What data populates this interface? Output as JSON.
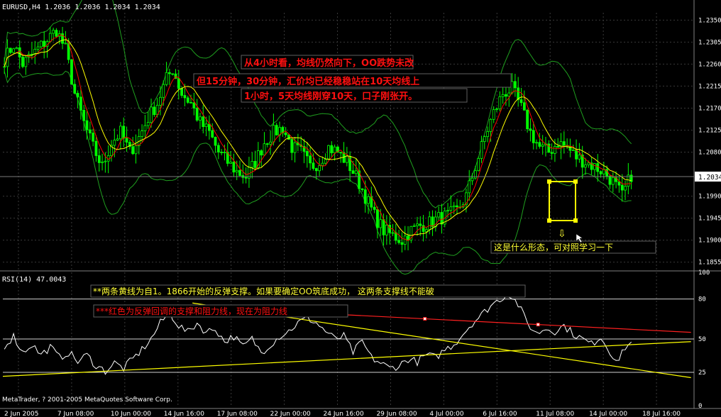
{
  "window": {
    "price_title": "EURUSD,H4  1.2036 1.2036 1.2034 1.2034",
    "rsi_title": "RSI(14) 47.0043",
    "copyright": "MetaTrader, ? 2001-2005 MetaQuotes Software Corp."
  },
  "colors": {
    "background": "#000000",
    "grid": "#3a3a3a",
    "candle": "#00ff00",
    "ma_fast": "#ff0000",
    "ma_slow": "#ffff00",
    "bollinger": "#1f9f1f",
    "rsi_line": "#ffffff",
    "annotation_red": "#ff1010",
    "annotation_yellow": "#ffff33"
  },
  "chart_data": [
    {
      "type": "candlestick",
      "title": "EURUSD,H4",
      "ohlc_last": {
        "open": 1.2036,
        "high": 1.2036,
        "low": 1.2034,
        "close": 1.2034
      },
      "current_price": "1.2034",
      "ylim": [
        1.184,
        1.2365
      ],
      "y_ticks": [
        "1.2350",
        "1.2305",
        "1.2260",
        "1.2215",
        "1.2170",
        "1.2125",
        "1.2080",
        "1.1990",
        "1.1945",
        "1.1900",
        "1.1855"
      ],
      "x_ticks": [
        "2 Jun 2005",
        "7 Jun 08:00",
        "10 Jun 00:00",
        "14 Jun 16:00",
        "17 Jun 08:00",
        "22 Jun 00:00",
        "24 Jun 16:00",
        "29 Jun 08:00",
        "4 Jul 00:00",
        "6 Jul 16:00",
        "11 Jul 08:00",
        "14 Jul 00:00",
        "18 Jul 16:00"
      ],
      "grid": true,
      "close_trace": [
        [
          0,
          1.227
        ],
        [
          3,
          1.23
        ],
        [
          6,
          1.226
        ],
        [
          10,
          1.2285
        ],
        [
          14,
          1.231
        ],
        [
          17,
          1.233
        ],
        [
          20,
          1.229
        ],
        [
          23,
          1.22
        ],
        [
          26,
          1.214
        ],
        [
          29,
          1.209
        ],
        [
          32,
          1.205
        ],
        [
          35,
          1.21
        ],
        [
          38,
          1.212
        ],
        [
          41,
          1.208
        ],
        [
          44,
          1.211
        ],
        [
          47,
          1.215
        ],
        [
          50,
          1.218
        ],
        [
          53,
          1.223
        ],
        [
          55,
          1.225
        ],
        [
          58,
          1.22
        ],
        [
          61,
          1.218
        ],
        [
          64,
          1.214
        ],
        [
          67,
          1.212
        ],
        [
          70,
          1.208
        ],
        [
          73,
          1.206
        ],
        [
          76,
          1.204
        ],
        [
          79,
          1.203
        ],
        [
          82,
          1.206
        ],
        [
          85,
          1.21
        ],
        [
          88,
          1.212
        ],
        [
          91,
          1.213
        ],
        [
          94,
          1.209
        ],
        [
          97,
          1.208
        ],
        [
          100,
          1.205
        ],
        [
          103,
          1.206
        ],
        [
          106,
          1.209
        ],
        [
          109,
          1.208
        ],
        [
          112,
          1.206
        ],
        [
          115,
          1.203
        ],
        [
          118,
          1.199
        ],
        [
          121,
          1.195
        ],
        [
          124,
          1.192
        ],
        [
          127,
          1.191
        ],
        [
          130,
          1.19
        ],
        [
          133,
          1.192
        ],
        [
          136,
          1.193
        ],
        [
          139,
          1.1935
        ],
        [
          142,
          1.1945
        ],
        [
          145,
          1.195
        ],
        [
          148,
          1.196
        ],
        [
          151,
          1.199
        ],
        [
          154,
          1.205
        ],
        [
          157,
          1.211
        ],
        [
          160,
          1.216
        ],
        [
          163,
          1.22
        ],
        [
          166,
          1.221
        ],
        [
          169,
          1.217
        ],
        [
          172,
          1.212
        ],
        [
          175,
          1.209
        ],
        [
          178,
          1.208
        ],
        [
          181,
          1.21
        ],
        [
          184,
          1.209
        ],
        [
          187,
          1.207
        ],
        [
          190,
          1.206
        ],
        [
          193,
          1.205
        ],
        [
          196,
          1.204
        ],
        [
          199,
          1.202
        ],
        [
          202,
          1.199
        ],
        [
          205,
          1.2034
        ]
      ],
      "annotations": [
        {
          "id": "ann_4h",
          "text": "从4小时看，均线仍然向下，OO跌势未改",
          "color": "red"
        },
        {
          "id": "ann_15m",
          "text": "但15分钟，30分钟，汇价均已经稳稳站在10天均线上",
          "color": "red"
        },
        {
          "id": "ann_1h",
          "text": "1小时，5天均线刚穿10天，口子刚张开。",
          "color": "red"
        },
        {
          "id": "ann_pattern",
          "text": "这是什么形态，可对照学习一下",
          "color": "yellow"
        },
        {
          "id": "ann_arrow",
          "text": "⇩",
          "color": "yellow"
        }
      ]
    },
    {
      "type": "line",
      "title": "RSI(14)",
      "value": "47.0043",
      "ylim": [
        0,
        100
      ],
      "y_ticks": [
        "100",
        "80",
        "50",
        "25",
        "0"
      ],
      "levels": [
        80,
        50,
        25
      ],
      "series": [
        {
          "values": [
            [
              0,
              45
            ],
            [
              3,
              52
            ],
            [
              6,
              40
            ],
            [
              9,
              46
            ],
            [
              12,
              38
            ],
            [
              15,
              44
            ],
            [
              18,
              36
            ],
            [
              21,
              40
            ],
            [
              24,
              33
            ],
            [
              27,
              38
            ],
            [
              30,
              30
            ],
            [
              33,
              26
            ],
            [
              36,
              32
            ],
            [
              39,
              28
            ],
            [
              42,
              35
            ],
            [
              45,
              42
            ],
            [
              48,
              50
            ],
            [
              51,
              62
            ],
            [
              54,
              70
            ],
            [
              57,
              60
            ],
            [
              60,
              55
            ],
            [
              63,
              62
            ],
            [
              66,
              55
            ],
            [
              69,
              58
            ],
            [
              72,
              48
            ],
            [
              75,
              52
            ],
            [
              78,
              44
            ],
            [
              81,
              50
            ],
            [
              84,
              40
            ],
            [
              87,
              46
            ],
            [
              90,
              52
            ],
            [
              93,
              56
            ],
            [
              96,
              62
            ],
            [
              99,
              66
            ],
            [
              102,
              62
            ],
            [
              105,
              56
            ],
            [
              108,
              50
            ],
            [
              111,
              52
            ],
            [
              114,
              40
            ],
            [
              117,
              48
            ],
            [
              120,
              36
            ],
            [
              123,
              32
            ],
            [
              126,
              28
            ],
            [
              129,
              30
            ],
            [
              132,
              35
            ],
            [
              135,
              33
            ],
            [
              138,
              38
            ],
            [
              141,
              36
            ],
            [
              144,
              42
            ],
            [
              147,
              46
            ],
            [
              150,
              54
            ],
            [
              153,
              62
            ],
            [
              156,
              68
            ],
            [
              159,
              75
            ],
            [
              162,
              80
            ],
            [
              165,
              84
            ],
            [
              168,
              76
            ],
            [
              171,
              62
            ],
            [
              174,
              54
            ],
            [
              177,
              58
            ],
            [
              180,
              56
            ],
            [
              183,
              60
            ],
            [
              186,
              54
            ],
            [
              189,
              50
            ],
            [
              192,
              46
            ],
            [
              195,
              52
            ],
            [
              198,
              40
            ],
            [
              201,
              34
            ],
            [
              203,
              44
            ],
            [
              205,
              47
            ]
          ]
        }
      ],
      "trendlines": [
        {
          "id": "red_resistance",
          "color": "red",
          "from": [
            62,
            74
          ],
          "to": [
            225,
            55
          ]
        },
        {
          "id": "yellow_falling",
          "color": "yellow",
          "from": [
            62,
            77
          ],
          "to": [
            225,
            21
          ]
        },
        {
          "id": "yellow_rising",
          "color": "yellow",
          "from": [
            0,
            22
          ],
          "to": [
            225,
            48
          ]
        }
      ],
      "annotations": [
        {
          "id": "ann_yellow",
          "text": "**两条黄线为自1。1866开始的反弹支撑。如果要确定OO筑底成功， 这两条支撑线不能破",
          "color": "yellow"
        },
        {
          "id": "ann_red",
          "text": "***红色为反弹回调的支撑和阻力线，现在为阻力线",
          "color": "red"
        }
      ]
    }
  ]
}
